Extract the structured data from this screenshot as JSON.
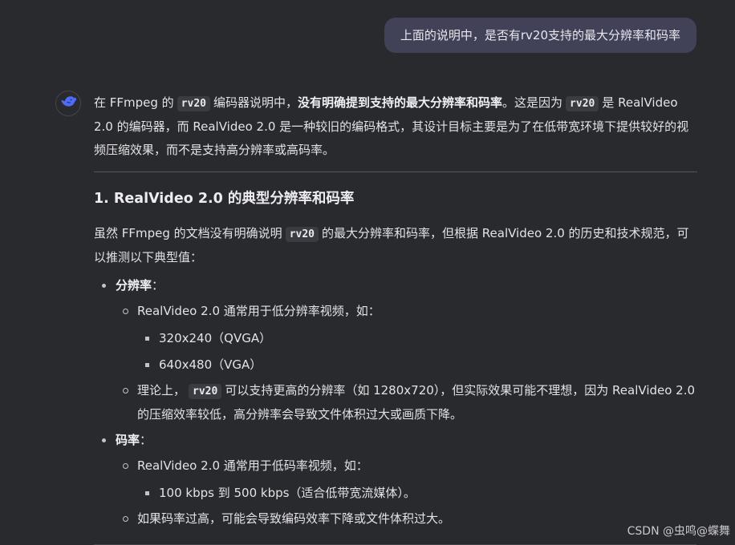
{
  "user_message": "上面的说明中，是否有rv20支持的最大分辨率和码率",
  "assistant": {
    "avatar_icon": "whale-logo-icon",
    "intro": {
      "t1": "在 FFmpeg 的",
      "code1": "rv20",
      "t2": "编码器说明中，",
      "bold": "没有明确提到支持的最大分辨率和码率",
      "t3": "。这是因为",
      "code2": "rv20",
      "t4": "是 RealVideo 2.0 的编码器，而 RealVideo 2.0 是一种较旧的编码格式，其设计目标主要是为了在低带宽环境下提供较好的视频压缩效果，而不是支持高分辨率或高码率。"
    },
    "section_title": "1. RealVideo 2.0 的典型分辨率和码率",
    "section_lead": {
      "t1": "虽然 FFmpeg 的文档没有明确说明",
      "code": "rv20",
      "t2": "的最大分辨率和码率，但根据 RealVideo 2.0 的历史和技术规范，可以推测以下典型值："
    },
    "resolution": {
      "label": "分辨率",
      "colon": "：",
      "common": "RealVideo 2.0 通常用于低分辨率视频，如：",
      "examples": [
        "320x240（QVGA）",
        "640x480（VGA）"
      ],
      "theory_t1": "理论上，",
      "theory_code": "rv20",
      "theory_t2": "可以支持更高的分辨率（如 1280x720），但实际效果可能不理想，因为 RealVideo 2.0 的压缩效率较低，高分辨率会导致文件体积过大或画质下降。"
    },
    "bitrate": {
      "label": "码率",
      "colon": "：",
      "common": "RealVideo 2.0 通常用于低码率视频，如：",
      "examples": [
        "100 kbps 到 500 kbps（适合低带宽流媒体）。"
      ],
      "too_high": "如果码率过高，可能会导致编码效率下降或文件体积过大。"
    }
  },
  "watermark": "CSDN @虫鸣@蝶舞",
  "colors": {
    "background": "#292a2d",
    "user_bubble": "#414158",
    "text": "#e3e3e6",
    "code_bg": "#3b3c41",
    "avatar_accent": "#4d6bfe"
  }
}
